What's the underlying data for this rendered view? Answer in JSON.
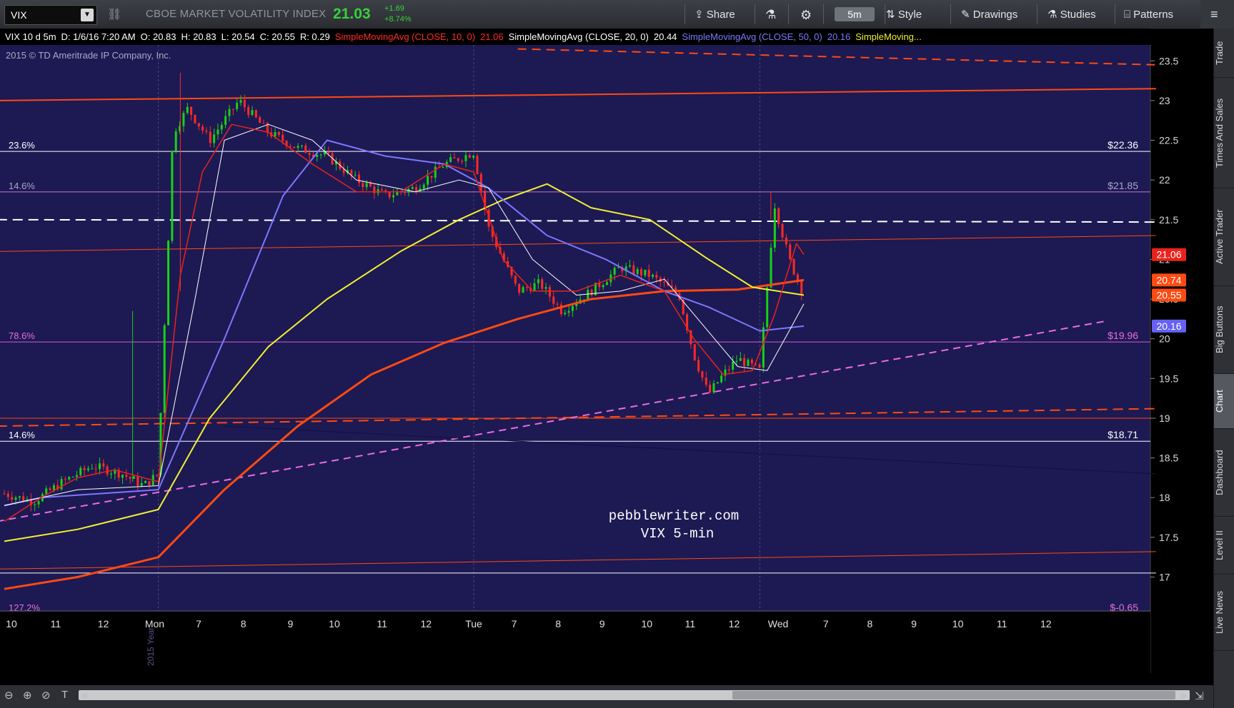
{
  "toolbar": {
    "symbol": "VIX",
    "description": "CBOE MARKET VOLATILITY INDEX",
    "last": "21.03",
    "change_abs": "+1.69",
    "change_pct": "+8.74%",
    "share_label": "Share",
    "timeframe": "5m",
    "style_label": "Style",
    "drawings_label": "Drawings",
    "studies_label": "Studies",
    "patterns_label": "Patterns"
  },
  "infobar": {
    "name": "VIX 10 d 5m",
    "date": "D: 1/6/16 7:20 AM",
    "open": "O: 20.83",
    "high": "H: 20.83",
    "low": "L: 20.54",
    "close": "C: 20.55",
    "range": "R: 0.29",
    "sma10_label": "SimpleMovingAvg (CLOSE, 10, 0)",
    "sma10_value": "21.06",
    "sma20_label": "SimpleMovingAvg (CLOSE, 20, 0)",
    "sma20_value": "20.44",
    "sma50_label": "SimpleMovingAvg (CLOSE, 50, 0)",
    "sma50_value": "20.16",
    "sma_more": "SimpleMoving..."
  },
  "copyright": "2015 © TD Ameritrade IP Company, Inc.",
  "watermark_line1": "pebblewriter.com",
  "watermark_line2": "VIX 5-min",
  "vertical_label": "2015 Year",
  "sidebar": [
    "Trade",
    "Times And Sales",
    "Active Trader",
    "Big Buttons",
    "Chart",
    "Dashboard",
    "Level II",
    "Live News"
  ],
  "colors": {
    "bg": "#1d1953",
    "up": "#19d116",
    "down": "#ff2b24",
    "sma10": "#e8231c",
    "sma20": "#ffffff",
    "sma50": "#7b78ff",
    "sma200": "#ff4a12",
    "yellow": "#f1f032",
    "fib": "#ffffff",
    "pink": "#e86ee0"
  },
  "chart_data": {
    "type": "candlestick",
    "y_axis": {
      "min": 16.6,
      "max": 23.7,
      "ticks": [
        17,
        17.5,
        18,
        18.5,
        19,
        19.5,
        20,
        20.5,
        21,
        21.5,
        22,
        22.5,
        23,
        23.5
      ]
    },
    "x_labels": [
      "10",
      "11",
      "12",
      "Mon",
      "7",
      "8",
      "9",
      "10",
      "11",
      "12",
      "Tue",
      "7",
      "8",
      "9",
      "10",
      "11",
      "12",
      "Wed",
      "7",
      "8",
      "9",
      "10",
      "11",
      "12"
    ],
    "price_tags": [
      {
        "value": "21.06",
        "color": "#e8231c"
      },
      {
        "value": "20.74",
        "color": "#ff4a12"
      },
      {
        "value": "20.55",
        "color": "#ff4a12"
      },
      {
        "value": "20.16",
        "color": "#6561f5"
      }
    ],
    "fib_levels": [
      {
        "label": "23.6%",
        "price": 22.36,
        "price_label": "$22.36"
      },
      {
        "label": "14.6%",
        "price": 21.85,
        "price_label": "$21.85"
      },
      {
        "label": "78.6%",
        "price": 19.96,
        "price_label": "$19.96"
      },
      {
        "label": "14.6%",
        "price": 18.71,
        "price_label": "$18.71"
      },
      {
        "label": "127.2%",
        "price": 16.5,
        "price_label": "$-0.65"
      }
    ],
    "close_series": [
      {
        "t": 0,
        "c": 18.05
      },
      {
        "t": 0.04,
        "c": 17.95
      },
      {
        "t": 0.08,
        "c": 18.2
      },
      {
        "t": 0.12,
        "c": 18.4
      },
      {
        "t": 0.16,
        "c": 18.3
      },
      {
        "t": 0.19,
        "c": 18.15
      },
      {
        "t": 0.21,
        "c": 18.3
      },
      {
        "t": 0.215,
        "c": 19.5
      },
      {
        "t": 0.23,
        "c": 22.6
      },
      {
        "t": 0.25,
        "c": 22.9
      },
      {
        "t": 0.28,
        "c": 22.5
      },
      {
        "t": 0.32,
        "c": 23.0
      },
      {
        "t": 0.36,
        "c": 22.6
      },
      {
        "t": 0.4,
        "c": 22.4
      },
      {
        "t": 0.44,
        "c": 22.3
      },
      {
        "t": 0.48,
        "c": 22.0
      },
      {
        "t": 0.52,
        "c": 21.8
      },
      {
        "t": 0.56,
        "c": 21.9
      },
      {
        "t": 0.6,
        "c": 22.2
      },
      {
        "t": 0.64,
        "c": 22.35
      },
      {
        "t": 0.66,
        "c": 21.4
      },
      {
        "t": 0.68,
        "c": 21.0
      },
      {
        "t": 0.7,
        "c": 20.6
      },
      {
        "t": 0.73,
        "c": 20.7
      },
      {
        "t": 0.76,
        "c": 20.35
      },
      {
        "t": 0.8,
        "c": 20.6
      },
      {
        "t": 0.84,
        "c": 20.9
      },
      {
        "t": 0.88,
        "c": 20.8
      },
      {
        "t": 0.92,
        "c": 20.55
      },
      {
        "t": 0.94,
        "c": 19.8
      },
      {
        "t": 0.96,
        "c": 19.3
      },
      {
        "t": 0.98,
        "c": 19.55
      },
      {
        "t": 1.0,
        "c": 19.75
      },
      {
        "t": 1.03,
        "c": 19.6
      },
      {
        "t": 1.05,
        "c": 21.7
      },
      {
        "t": 1.07,
        "c": 21.0
      },
      {
        "t": 1.09,
        "c": 20.55
      }
    ],
    "sma10": [
      {
        "t": 0,
        "c": 17.7
      },
      {
        "t": 0.05,
        "c": 18.0
      },
      {
        "t": 0.1,
        "c": 18.25
      },
      {
        "t": 0.15,
        "c": 18.35
      },
      {
        "t": 0.21,
        "c": 18.2
      },
      {
        "t": 0.24,
        "c": 20.8
      },
      {
        "t": 0.27,
        "c": 22.1
      },
      {
        "t": 0.31,
        "c": 22.7
      },
      {
        "t": 0.36,
        "c": 22.6
      },
      {
        "t": 0.42,
        "c": 22.2
      },
      {
        "t": 0.48,
        "c": 21.85
      },
      {
        "t": 0.54,
        "c": 21.85
      },
      {
        "t": 0.6,
        "c": 22.2
      },
      {
        "t": 0.64,
        "c": 22.1
      },
      {
        "t": 0.68,
        "c": 21.0
      },
      {
        "t": 0.72,
        "c": 20.6
      },
      {
        "t": 0.78,
        "c": 20.6
      },
      {
        "t": 0.84,
        "c": 20.8
      },
      {
        "t": 0.9,
        "c": 20.6
      },
      {
        "t": 0.94,
        "c": 20.0
      },
      {
        "t": 0.98,
        "c": 19.55
      },
      {
        "t": 1.02,
        "c": 19.6
      },
      {
        "t": 1.05,
        "c": 20.3
      },
      {
        "t": 1.08,
        "c": 21.2
      },
      {
        "t": 1.09,
        "c": 21.06
      }
    ],
    "sma20": [
      {
        "t": 0,
        "c": 17.9
      },
      {
        "t": 0.1,
        "c": 18.1
      },
      {
        "t": 0.21,
        "c": 18.15
      },
      {
        "t": 0.26,
        "c": 20.5
      },
      {
        "t": 0.3,
        "c": 22.5
      },
      {
        "t": 0.36,
        "c": 22.7
      },
      {
        "t": 0.42,
        "c": 22.5
      },
      {
        "t": 0.48,
        "c": 22.0
      },
      {
        "t": 0.56,
        "c": 21.85
      },
      {
        "t": 0.62,
        "c": 22.0
      },
      {
        "t": 0.66,
        "c": 21.9
      },
      {
        "t": 0.72,
        "c": 21.0
      },
      {
        "t": 0.78,
        "c": 20.55
      },
      {
        "t": 0.84,
        "c": 20.6
      },
      {
        "t": 0.9,
        "c": 20.75
      },
      {
        "t": 0.95,
        "c": 20.2
      },
      {
        "t": 1.0,
        "c": 19.65
      },
      {
        "t": 1.04,
        "c": 19.6
      },
      {
        "t": 1.07,
        "c": 20.1
      },
      {
        "t": 1.09,
        "c": 20.44
      }
    ],
    "sma50": [
      {
        "t": 0,
        "c": 17.9
      },
      {
        "t": 0.05,
        "c": 18.0
      },
      {
        "t": 0.21,
        "c": 18.1
      },
      {
        "t": 0.3,
        "c": 20.0
      },
      {
        "t": 0.38,
        "c": 21.8
      },
      {
        "t": 0.44,
        "c": 22.5
      },
      {
        "t": 0.52,
        "c": 22.3
      },
      {
        "t": 0.6,
        "c": 22.2
      },
      {
        "t": 0.66,
        "c": 21.9
      },
      {
        "t": 0.74,
        "c": 21.3
      },
      {
        "t": 0.82,
        "c": 21.0
      },
      {
        "t": 0.9,
        "c": 20.6
      },
      {
        "t": 0.96,
        "c": 20.4
      },
      {
        "t": 1.03,
        "c": 20.1
      },
      {
        "t": 1.09,
        "c": 20.16
      }
    ],
    "sma_yellow": [
      {
        "t": 0,
        "c": 17.45
      },
      {
        "t": 0.1,
        "c": 17.6
      },
      {
        "t": 0.21,
        "c": 17.85
      },
      {
        "t": 0.28,
        "c": 19.0
      },
      {
        "t": 0.36,
        "c": 19.9
      },
      {
        "t": 0.44,
        "c": 20.5
      },
      {
        "t": 0.54,
        "c": 21.1
      },
      {
        "t": 0.62,
        "c": 21.5
      },
      {
        "t": 0.68,
        "c": 21.75
      },
      {
        "t": 0.74,
        "c": 21.95
      },
      {
        "t": 0.8,
        "c": 21.65
      },
      {
        "t": 0.88,
        "c": 21.5
      },
      {
        "t": 0.96,
        "c": 21.0
      },
      {
        "t": 1.02,
        "c": 20.65
      },
      {
        "t": 1.09,
        "c": 20.55
      }
    ],
    "sma_orange": [
      {
        "t": 0,
        "c": 16.85
      },
      {
        "t": 0.1,
        "c": 17.0
      },
      {
        "t": 0.21,
        "c": 17.25
      },
      {
        "t": 0.3,
        "c": 18.1
      },
      {
        "t": 0.4,
        "c": 18.9
      },
      {
        "t": 0.5,
        "c": 19.55
      },
      {
        "t": 0.6,
        "c": 19.95
      },
      {
        "t": 0.7,
        "c": 20.25
      },
      {
        "t": 0.8,
        "c": 20.5
      },
      {
        "t": 0.9,
        "c": 20.6
      },
      {
        "t": 1.0,
        "c": 20.62
      },
      {
        "t": 1.09,
        "c": 20.74
      }
    ]
  }
}
